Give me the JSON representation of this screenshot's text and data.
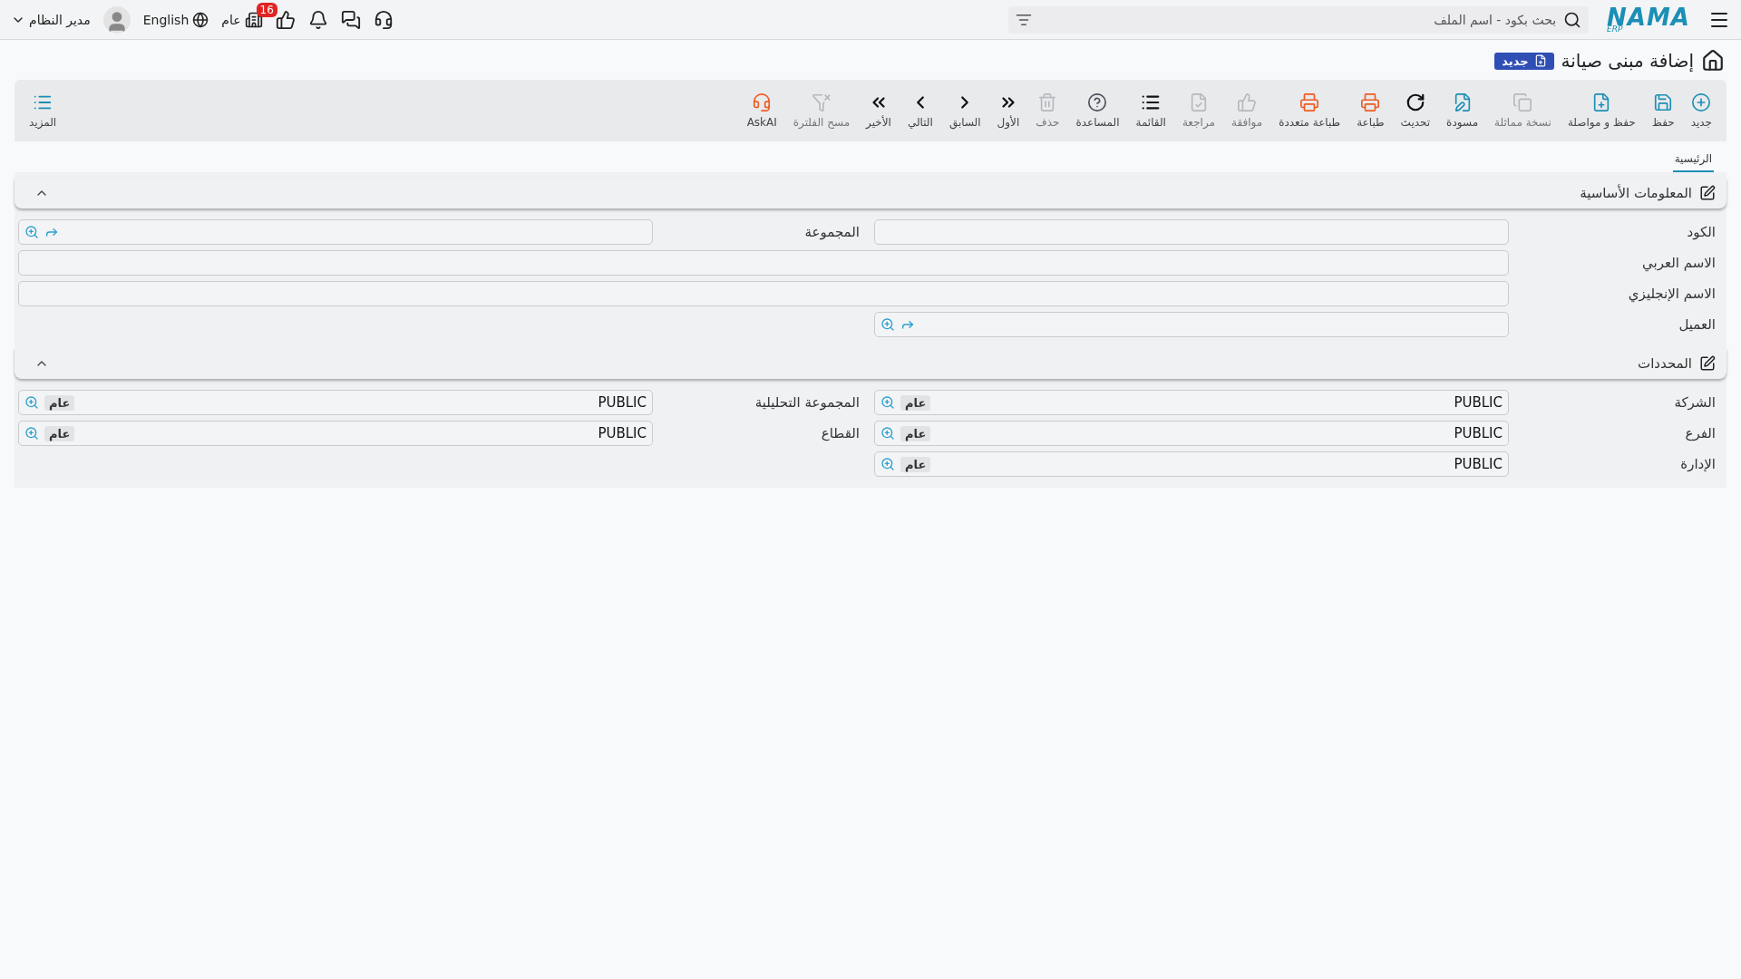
{
  "topbar": {
    "logo": {
      "name": "NAMA",
      "suffix": "ERP"
    },
    "search": {
      "placeholder": "بحث بكود - اسم الملف"
    },
    "icons": [
      {
        "kind": "ai"
      },
      {
        "kind": "chat"
      },
      {
        "kind": "bell"
      },
      {
        "kind": "approvals",
        "badge": "16"
      }
    ],
    "company": "عام",
    "language": "English",
    "user": "مدير النظام"
  },
  "title": {
    "text": "إضافة مبنى صيانة",
    "badge": "جديد"
  },
  "toolbar": [
    {
      "kind": "new",
      "label": "جديد",
      "color": "#1b8fb5",
      "disabled": false
    },
    {
      "kind": "save",
      "label": "حفظ",
      "color": "#1b8fb5",
      "disabled": false
    },
    {
      "kind": "save-continue",
      "label": "حفظ و مواصلة",
      "color": "#1b8fb5",
      "disabled": false
    },
    {
      "kind": "copy",
      "label": "نسخة مماثلة",
      "color": "#b5b8bd",
      "disabled": true
    },
    {
      "kind": "draft",
      "label": "مسودة",
      "color": "#1b8fb5",
      "disabled": false
    },
    {
      "kind": "refresh",
      "label": "تحديث",
      "color": "#111111",
      "disabled": false
    },
    {
      "kind": "print",
      "label": "طباعة",
      "color": "#f05a22",
      "disabled": false
    },
    {
      "kind": "multi-print",
      "label": "طباعة متعددة",
      "color": "#f05a22",
      "disabled": false
    },
    {
      "kind": "approve",
      "label": "موافقة",
      "color": "#b5b8bd",
      "disabled": true
    },
    {
      "kind": "review",
      "label": "مراجعة",
      "color": "#b5b8bd",
      "disabled": true
    },
    {
      "kind": "list",
      "label": "القائمة",
      "color": "#111111",
      "disabled": false
    },
    {
      "kind": "help",
      "label": "المساعدة",
      "color": "#4a4f57",
      "disabled": false
    },
    {
      "kind": "delete",
      "label": "حذف",
      "color": "#b5b8bd",
      "disabled": true
    },
    {
      "kind": "first",
      "label": "الأول",
      "color": "#111111",
      "disabled": false
    },
    {
      "kind": "previous",
      "label": "السابق",
      "color": "#111111",
      "disabled": false
    },
    {
      "kind": "next",
      "label": "التالي",
      "color": "#111111",
      "disabled": false
    },
    {
      "kind": "last",
      "label": "الأخير",
      "color": "#111111",
      "disabled": false
    },
    {
      "kind": "clear-filter",
      "label": "مسح الفلترة",
      "color": "#b5b8bd",
      "disabled": true
    },
    {
      "kind": "ask-ai",
      "label": "AskAI",
      "color": "#f05a22",
      "disabled": false
    }
  ],
  "more": {
    "label": "المزيد"
  },
  "tabs": [
    {
      "label": "الرئيسية",
      "selected": true
    }
  ],
  "sections": [
    {
      "title": "المعلومات الأساسية",
      "expanded": true,
      "rows": [
        {
          "wide": false,
          "fields": [
            {
              "label": "الكود",
              "kind": "text"
            },
            {
              "label": "المجموعة",
              "kind": "lookup"
            }
          ]
        },
        {
          "wide": true,
          "fields": [
            {
              "label": "الاسم العربي",
              "kind": "text"
            }
          ]
        },
        {
          "wide": true,
          "fields": [
            {
              "label": "الاسم الإنجليزي",
              "kind": "text"
            }
          ]
        },
        {
          "wide": false,
          "fields": [
            {
              "label": "العميل",
              "kind": "lookup"
            }
          ]
        }
      ]
    },
    {
      "title": "المحددات",
      "expanded": true,
      "rows": [
        {
          "wide": false,
          "fields": [
            {
              "label": "الشركة",
              "kind": "lookup",
              "value": "PUBLIC",
              "tag": "عام"
            },
            {
              "label": "المجموعة التحليلية",
              "kind": "lookup",
              "value": "PUBLIC",
              "tag": "عام"
            }
          ]
        },
        {
          "wide": false,
          "fields": [
            {
              "label": "الفرع",
              "kind": "lookup",
              "value": "PUBLIC",
              "tag": "عام"
            },
            {
              "label": "القطاع",
              "kind": "lookup",
              "value": "PUBLIC",
              "tag": "عام"
            }
          ]
        },
        {
          "wide": false,
          "fields": [
            {
              "label": "الإدارة",
              "kind": "lookup",
              "value": "PUBLIC",
              "tag": "عام"
            }
          ]
        }
      ]
    }
  ]
}
